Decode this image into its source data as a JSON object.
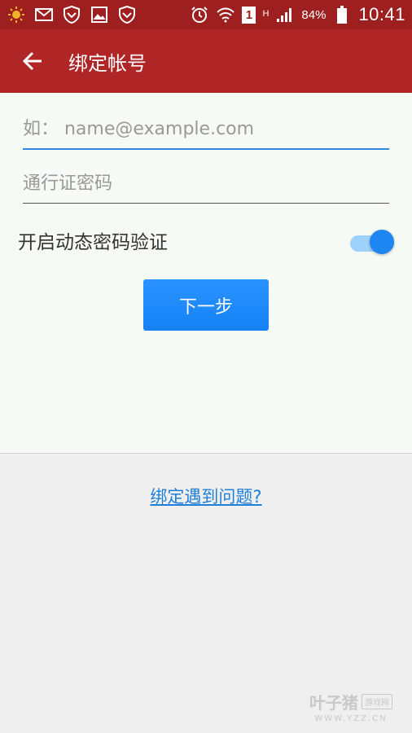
{
  "status_bar": {
    "icons_left": [
      "sun-icon",
      "mail-icon",
      "shield-icon",
      "image-icon",
      "shield-icon"
    ],
    "icons_right": [
      "alarm-icon",
      "wifi-icon",
      "sim-icon",
      "signal-icon",
      "battery-icon"
    ],
    "sim_label": "1",
    "network_label": "H",
    "battery": "84%",
    "time": "10:41"
  },
  "header": {
    "back_icon": "back-arrow-icon",
    "title": "绑定帐号"
  },
  "form": {
    "email_placeholder": "如： name@example.com",
    "password_placeholder": "通行证密码",
    "dynamic_password_label": "开启动态密码验证",
    "dynamic_password_enabled": true,
    "next_button": "下一步"
  },
  "help_link": "绑定遇到问题?",
  "watermark": {
    "name": "叶子猪",
    "badge": "游戏网",
    "url": "WWW.YZZ.CN"
  },
  "colors": {
    "status_bar": "#9e1f1f",
    "app_bar": "#b02525",
    "accent": "#1e86f0",
    "link": "#1f7fd8"
  }
}
